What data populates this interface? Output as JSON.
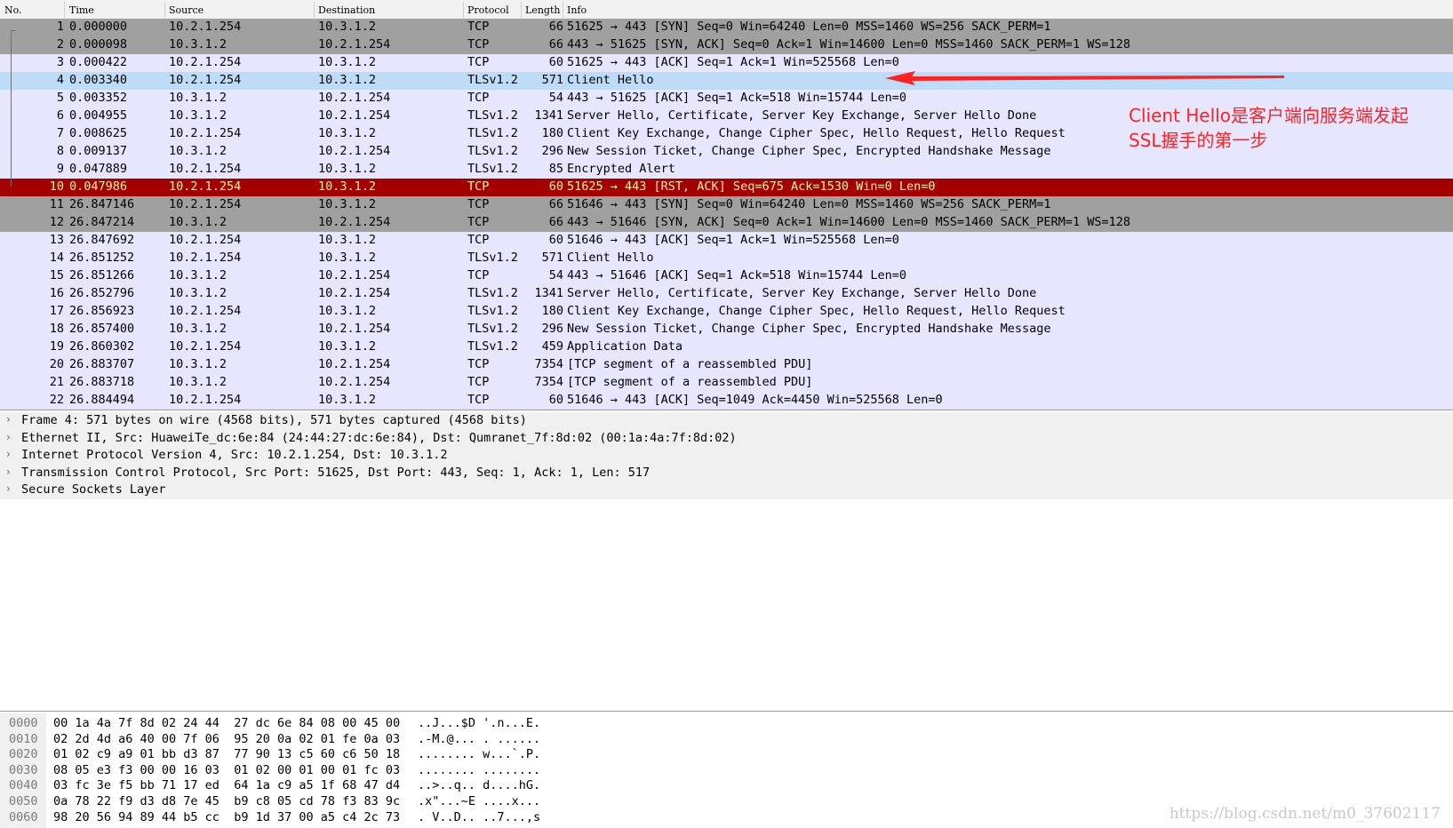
{
  "columns": [
    "No.",
    "Time",
    "Source",
    "Destination",
    "Protocol",
    "Length",
    "Info"
  ],
  "packets": [
    {
      "no": "1",
      "time": "0.000000",
      "src": "10.2.1.254",
      "dst": "10.3.1.2",
      "proto": "TCP",
      "len": "66",
      "info": "51625 → 443 [SYN] Seq=0 Win=64240 Len=0 MSS=1460 WS=256 SACK_PERM=1",
      "style": "gray"
    },
    {
      "no": "2",
      "time": "0.000098",
      "src": "10.3.1.2",
      "dst": "10.2.1.254",
      "proto": "TCP",
      "len": "66",
      "info": "443 → 51625 [SYN, ACK] Seq=0 Ack=1 Win=14600 Len=0 MSS=1460 SACK_PERM=1 WS=128",
      "style": "gray"
    },
    {
      "no": "3",
      "time": "0.000422",
      "src": "10.2.1.254",
      "dst": "10.3.1.2",
      "proto": "TCP",
      "len": "60",
      "info": "51625 → 443 [ACK] Seq=1 Ack=1 Win=525568 Len=0",
      "style": "lav"
    },
    {
      "no": "4",
      "time": "0.003340",
      "src": "10.2.1.254",
      "dst": "10.3.1.2",
      "proto": "TLSv1.2",
      "len": "571",
      "info": "Client Hello",
      "style": "sel"
    },
    {
      "no": "5",
      "time": "0.003352",
      "src": "10.3.1.2",
      "dst": "10.2.1.254",
      "proto": "TCP",
      "len": "54",
      "info": "443 → 51625 [ACK] Seq=1 Ack=518 Win=15744 Len=0",
      "style": "lav"
    },
    {
      "no": "6",
      "time": "0.004955",
      "src": "10.3.1.2",
      "dst": "10.2.1.254",
      "proto": "TLSv1.2",
      "len": "1341",
      "info": "Server Hello, Certificate, Server Key Exchange, Server Hello Done",
      "style": "lav"
    },
    {
      "no": "7",
      "time": "0.008625",
      "src": "10.2.1.254",
      "dst": "10.3.1.2",
      "proto": "TLSv1.2",
      "len": "180",
      "info": "Client Key Exchange, Change Cipher Spec, Hello Request, Hello Request",
      "style": "lav"
    },
    {
      "no": "8",
      "time": "0.009137",
      "src": "10.3.1.2",
      "dst": "10.2.1.254",
      "proto": "TLSv1.2",
      "len": "296",
      "info": "New Session Ticket, Change Cipher Spec, Encrypted Handshake Message",
      "style": "lav"
    },
    {
      "no": "9",
      "time": "0.047889",
      "src": "10.2.1.254",
      "dst": "10.3.1.2",
      "proto": "TLSv1.2",
      "len": "85",
      "info": "Encrypted Alert",
      "style": "lav"
    },
    {
      "no": "10",
      "time": "0.047986",
      "src": "10.2.1.254",
      "dst": "10.3.1.2",
      "proto": "TCP",
      "len": "60",
      "info": "51625 → 443 [RST, ACK] Seq=675 Ack=1530 Win=0 Len=0",
      "style": "rst"
    },
    {
      "no": "11",
      "time": "26.847146",
      "src": "10.2.1.254",
      "dst": "10.3.1.2",
      "proto": "TCP",
      "len": "66",
      "info": "51646 → 443 [SYN] Seq=0 Win=64240 Len=0 MSS=1460 WS=256 SACK_PERM=1",
      "style": "gray"
    },
    {
      "no": "12",
      "time": "26.847214",
      "src": "10.3.1.2",
      "dst": "10.2.1.254",
      "proto": "TCP",
      "len": "66",
      "info": "443 → 51646 [SYN, ACK] Seq=0 Ack=1 Win=14600 Len=0 MSS=1460 SACK_PERM=1 WS=128",
      "style": "gray"
    },
    {
      "no": "13",
      "time": "26.847692",
      "src": "10.2.1.254",
      "dst": "10.3.1.2",
      "proto": "TCP",
      "len": "60",
      "info": "51646 → 443 [ACK] Seq=1 Ack=1 Win=525568 Len=0",
      "style": "lav"
    },
    {
      "no": "14",
      "time": "26.851252",
      "src": "10.2.1.254",
      "dst": "10.3.1.2",
      "proto": "TLSv1.2",
      "len": "571",
      "info": "Client Hello",
      "style": "lav"
    },
    {
      "no": "15",
      "time": "26.851266",
      "src": "10.3.1.2",
      "dst": "10.2.1.254",
      "proto": "TCP",
      "len": "54",
      "info": "443 → 51646 [ACK] Seq=1 Ack=518 Win=15744 Len=0",
      "style": "lav"
    },
    {
      "no": "16",
      "time": "26.852796",
      "src": "10.3.1.2",
      "dst": "10.2.1.254",
      "proto": "TLSv1.2",
      "len": "1341",
      "info": "Server Hello, Certificate, Server Key Exchange, Server Hello Done",
      "style": "lav"
    },
    {
      "no": "17",
      "time": "26.856923",
      "src": "10.2.1.254",
      "dst": "10.3.1.2",
      "proto": "TLSv1.2",
      "len": "180",
      "info": "Client Key Exchange, Change Cipher Spec, Hello Request, Hello Request",
      "style": "lav"
    },
    {
      "no": "18",
      "time": "26.857400",
      "src": "10.3.1.2",
      "dst": "10.2.1.254",
      "proto": "TLSv1.2",
      "len": "296",
      "info": "New Session Ticket, Change Cipher Spec, Encrypted Handshake Message",
      "style": "lav"
    },
    {
      "no": "19",
      "time": "26.860302",
      "src": "10.2.1.254",
      "dst": "10.3.1.2",
      "proto": "TLSv1.2",
      "len": "459",
      "info": "Application Data",
      "style": "lav"
    },
    {
      "no": "20",
      "time": "26.883707",
      "src": "10.3.1.2",
      "dst": "10.2.1.254",
      "proto": "TCP",
      "len": "7354",
      "info": "[TCP segment of a reassembled PDU]",
      "style": "lav"
    },
    {
      "no": "21",
      "time": "26.883718",
      "src": "10.3.1.2",
      "dst": "10.2.1.254",
      "proto": "TCP",
      "len": "7354",
      "info": "[TCP segment of a reassembled PDU]",
      "style": "lav"
    },
    {
      "no": "22",
      "time": "26.884494",
      "src": "10.2.1.254",
      "dst": "10.3.1.2",
      "proto": "TCP",
      "len": "60",
      "info": "51646 → 443 [ACK] Seq=1049 Ack=4450 Win=525568 Len=0",
      "style": "lav"
    }
  ],
  "details": [
    "Frame 4: 571 bytes on wire (4568 bits), 571 bytes captured (4568 bits)",
    "Ethernet II, Src: HuaweiTe_dc:6e:84 (24:44:27:dc:6e:84), Dst: Qumranet_7f:8d:02 (00:1a:4a:7f:8d:02)",
    "Internet Protocol Version 4, Src: 10.2.1.254, Dst: 10.3.1.2",
    "Transmission Control Protocol, Src Port: 51625, Dst Port: 443, Seq: 1, Ack: 1, Len: 517",
    "Secure Sockets Layer"
  ],
  "hex_rows": [
    {
      "offset": "0000",
      "bytes": "00 1a 4a 7f 8d 02 24 44  27 dc 6e 84 08 00 45 00",
      "ascii": "..J...$D '.n...E."
    },
    {
      "offset": "0010",
      "bytes": "02 2d 4d a6 40 00 7f 06  95 20 0a 02 01 fe 0a 03",
      "ascii": ".-M.@... . ......"
    },
    {
      "offset": "0020",
      "bytes": "01 02 c9 a9 01 bb d3 87  77 90 13 c5 60 c6 50 18",
      "ascii": "........ w...`.P."
    },
    {
      "offset": "0030",
      "bytes": "08 05 e3 f3 00 00 16 03  01 02 00 01 00 01 fc 03",
      "ascii": "........ ........"
    },
    {
      "offset": "0040",
      "bytes": "03 fc 3e f5 bb 71 17 ed  64 1a c9 a5 1f 68 47 d4",
      "ascii": "..>..q.. d....hG."
    },
    {
      "offset": "0050",
      "bytes": "0a 78 22 f9 d3 d8 7e 45  b9 c8 05 cd 78 f3 83 9c",
      "ascii": ".x\"...~E ....x..."
    },
    {
      "offset": "0060",
      "bytes": "98 20 56 94 89 44 b5 cc  b9 1d 37 00 a5 c4 2c 73",
      "ascii": ". V..D.. ..7...,s"
    }
  ],
  "annotation": {
    "line1": "Client Hello是客户端向服务端发起",
    "line2": "SSL握手的第一步",
    "color": "#ff2222"
  },
  "watermark": "https://blog.csdn.net/m0_37602117",
  "colors": {
    "selected": "#bcdcf7",
    "rst_bg": "#a40000",
    "rst_fg": "#fff3a6",
    "syn_gray": "#a0a0a0",
    "tcp_lavender": "#e7e6ff"
  },
  "icons": {
    "expand": "chevron-right-icon"
  }
}
